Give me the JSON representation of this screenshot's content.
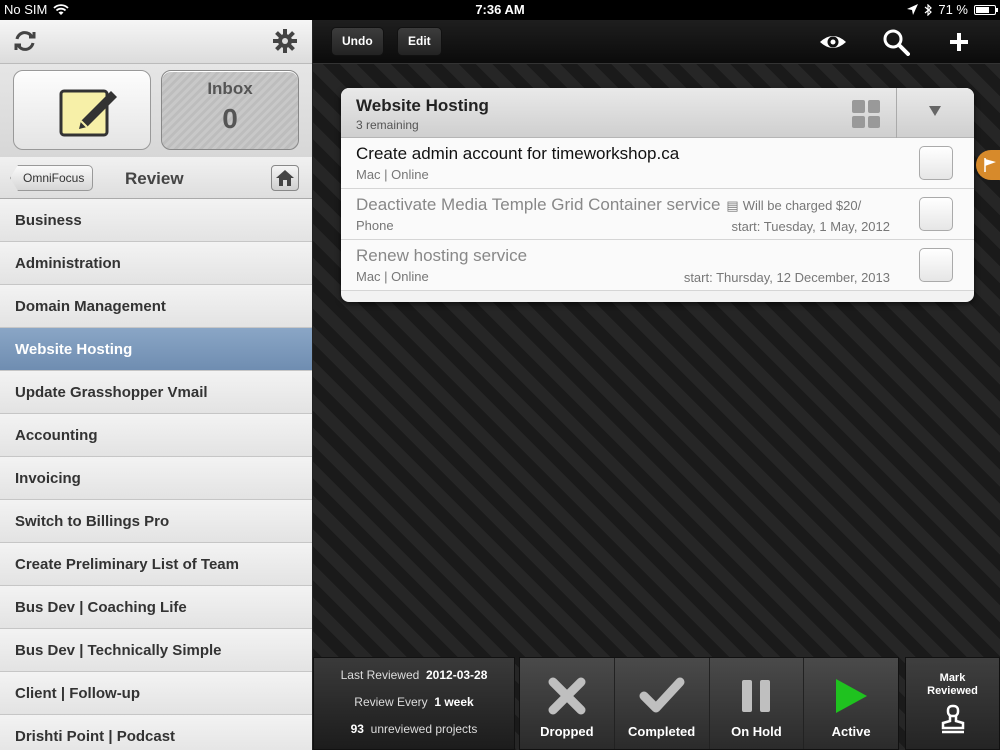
{
  "status": {
    "carrier": "No SIM",
    "time": "7:36 AM",
    "battery": "71 %",
    "battery_level": 0.71
  },
  "sidebar": {
    "inbox_label": "Inbox",
    "inbox_count": "0",
    "back_label": "OmniFocus",
    "title": "Review",
    "items": [
      {
        "label": "Business"
      },
      {
        "label": "Administration"
      },
      {
        "label": "Domain Management"
      },
      {
        "label": "Website Hosting",
        "selected": true
      },
      {
        "label": "Update Grasshopper Vmail"
      },
      {
        "label": "Accounting"
      },
      {
        "label": "Invoicing"
      },
      {
        "label": "Switch to Billings Pro"
      },
      {
        "label": "Create Preliminary List of Team"
      },
      {
        "label": "Bus Dev | Coaching Life"
      },
      {
        "label": "Bus Dev | Technically Simple"
      },
      {
        "label": "Client | Follow-up"
      },
      {
        "label": "Drishti Point | Podcast"
      }
    ]
  },
  "toolbar": {
    "undo_label": "Undo",
    "edit_label": "Edit"
  },
  "project": {
    "title": "Website Hosting",
    "remaining": "3 remaining",
    "tasks": [
      {
        "title": "Create admin account for timeworkshop.ca",
        "context": "Mac | Online",
        "note": "",
        "start": ""
      },
      {
        "title": "Deactivate Media Temple Grid Container service",
        "context": "Phone",
        "note": "Will be charged $20/",
        "start": "start: Tuesday, 1 May, 2012"
      },
      {
        "title": "Renew hosting service",
        "context": "Mac | Online",
        "note": "",
        "start": "start: Thursday, 12 December, 2013"
      }
    ]
  },
  "review": {
    "last_reviewed_label": "Last Reviewed",
    "last_reviewed_value": "2012-03-28",
    "review_every_label": "Review Every",
    "review_every_value": "1 week",
    "unreviewed_count": "93",
    "unreviewed_label": "unreviewed projects"
  },
  "status_buttons": {
    "dropped": "Dropped",
    "completed": "Completed",
    "on_hold": "On Hold",
    "active": "Active"
  },
  "mark_reviewed": {
    "line1": "Mark",
    "line2": "Reviewed"
  },
  "colors": {
    "selected_row": "#7b98bb",
    "active_green": "#1fc21f",
    "flag_orange": "#d78a2b"
  }
}
